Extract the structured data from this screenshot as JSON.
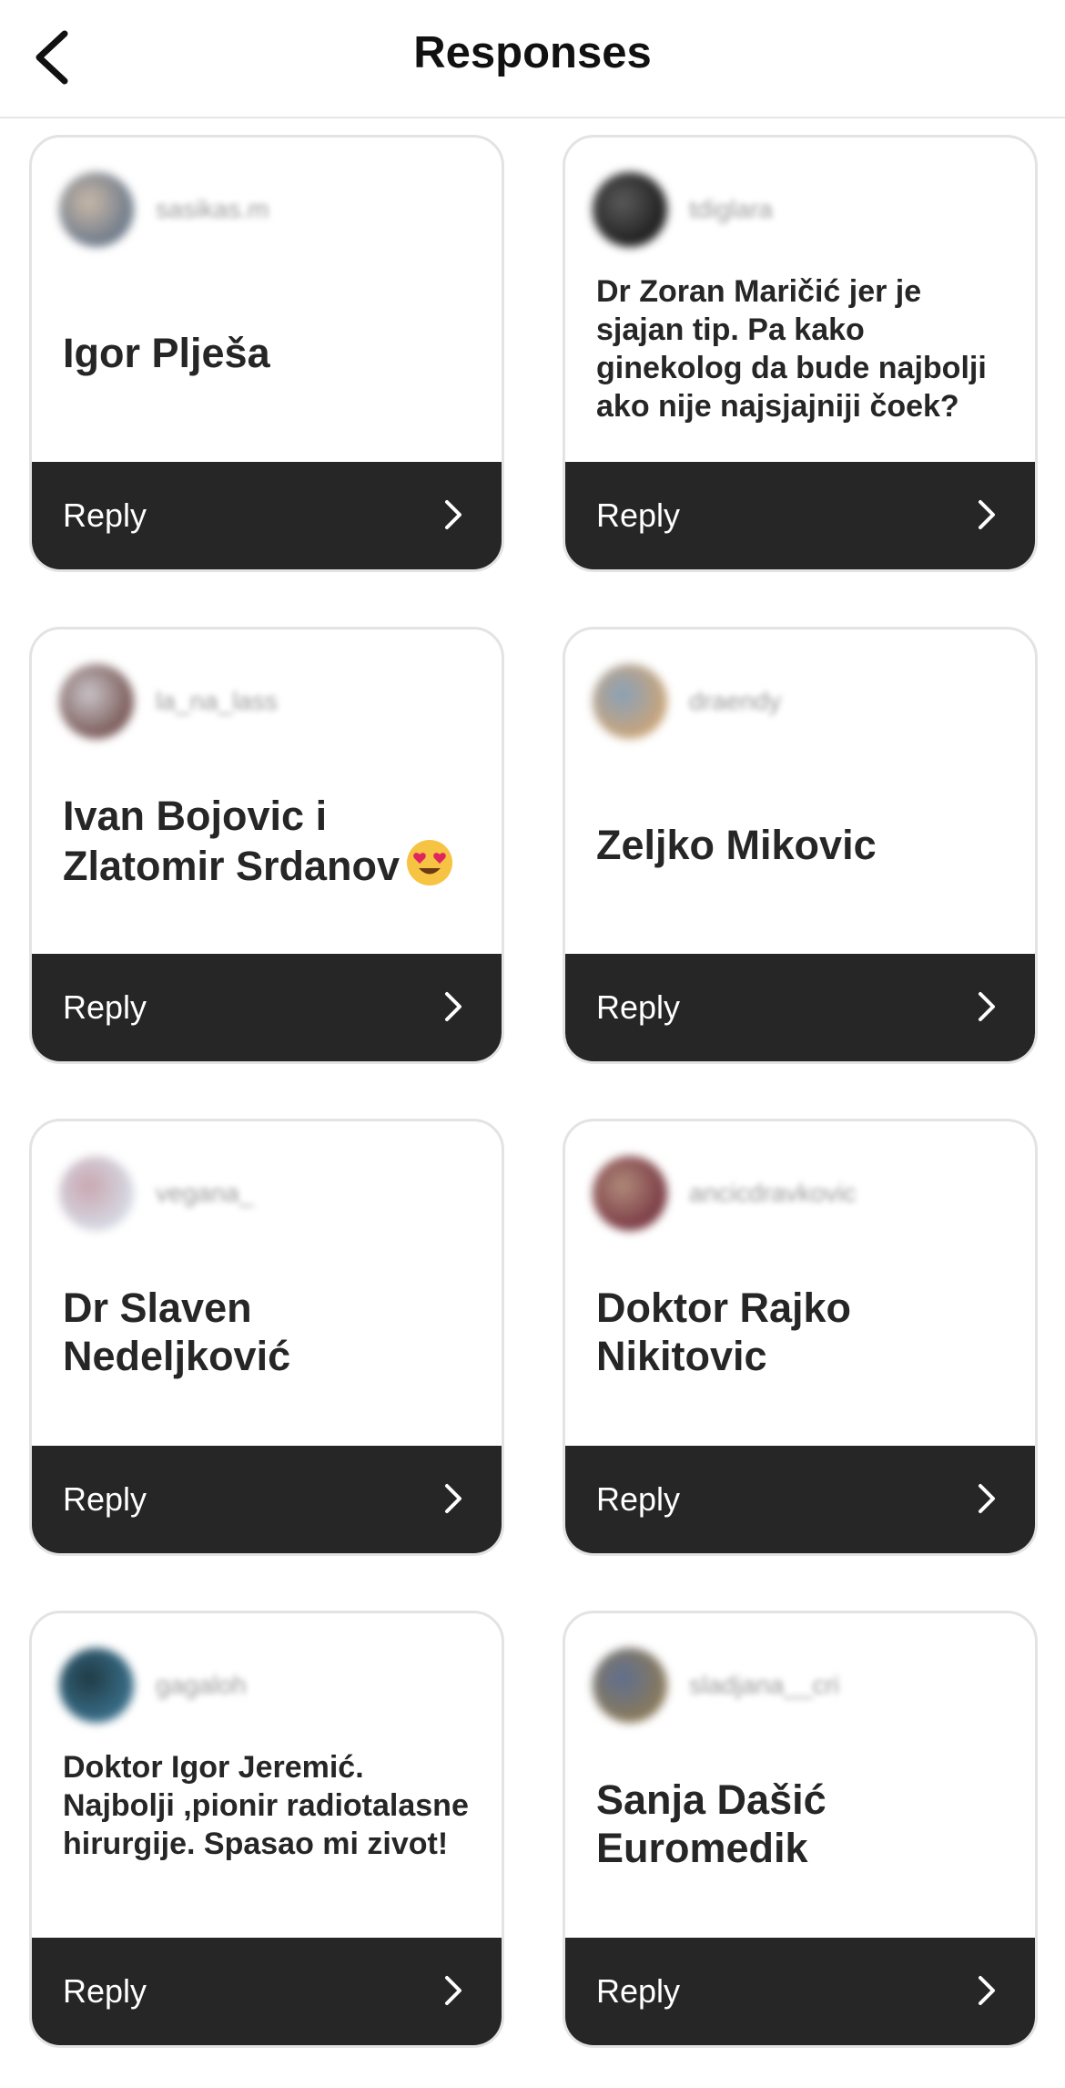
{
  "header": {
    "title": "Responses"
  },
  "responses": [
    {
      "username": "sasikas.m",
      "text": "Igor Plješa",
      "size": "big",
      "reply_label": "Reply",
      "avatar_colors": [
        "#6d7a8a",
        "#c9b8a8"
      ]
    },
    {
      "username": "tdiglara",
      "text": "Dr Zoran Maričić jer je sjajan tip. Pa kako ginekolog da bude najbolji ako nije najsjajniji čoek?",
      "size": "small",
      "reply_label": "Reply",
      "avatar_colors": [
        "#1e1e1e",
        "#5a5a5a"
      ]
    },
    {
      "username": "la_na_lass",
      "text": "Ivan Bojovic i Zlatomir Srdanov",
      "emoji": "heart-eyes",
      "size": "big",
      "reply_label": "Reply",
      "avatar_colors": [
        "#7a5a58",
        "#c9c4c8"
      ]
    },
    {
      "username": "draendy",
      "text": "Zeljko Mikovic",
      "size": "big",
      "reply_label": "Reply",
      "avatar_colors": [
        "#c9a47a",
        "#8aa1b8"
      ]
    },
    {
      "username": "vegana_",
      "text": "Dr Slaven Nedeljković",
      "size": "big",
      "reply_label": "Reply",
      "avatar_colors": [
        "#d6d9e4",
        "#c9a7b0"
      ]
    },
    {
      "username": "ancicdravkovic",
      "text": "Doktor Rajko Nikitovic",
      "size": "big",
      "reply_label": "Reply",
      "avatar_colors": [
        "#7a3a44",
        "#b08a7a"
      ]
    },
    {
      "username": "gagaloh",
      "text": "Doktor Igor Jeremić. Najbolji ,pionir radiotalasne hirurgije. Spasao mi zivot!",
      "size": "small",
      "reply_label": "Reply",
      "avatar_colors": [
        "#3a6f8a",
        "#1f3a44"
      ]
    },
    {
      "username": "sladjana__cri",
      "text": "Sanja Dašić Euromedik",
      "size": "big",
      "reply_label": "Reply",
      "avatar_colors": [
        "#8a7a5a",
        "#5f6f8f"
      ]
    }
  ]
}
